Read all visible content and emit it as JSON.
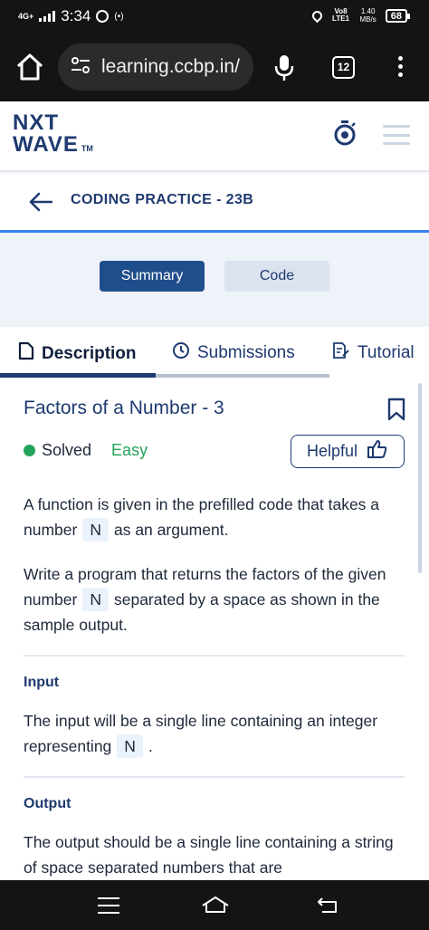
{
  "status_bar": {
    "network": "4G+",
    "time": "3:34",
    "volte": "Vo8 LTE1",
    "speed_value": "1.40",
    "speed_unit": "MB/s",
    "battery": "68"
  },
  "browser": {
    "url": "learning.ccbp.in/",
    "tab_count": "12"
  },
  "app": {
    "logo_line1": "NXT",
    "logo_line2": "WAVE",
    "logo_tm": "TM"
  },
  "page": {
    "back_title": "CODING PRACTICE - 23B"
  },
  "toggle": {
    "summary_label": "Summary",
    "code_label": "Code"
  },
  "tabs": {
    "description": "Description",
    "submissions": "Submissions",
    "tutorial": "Tutorial"
  },
  "problem": {
    "title": "Factors of a Number - 3",
    "status": "Solved",
    "difficulty": "Easy",
    "helpful_label": "Helpful",
    "para1_a": "A function is given in the prefilled code that takes a number",
    "para1_chip": "N",
    "para1_b": "as an argument.",
    "para2_a": "Write a program that returns the factors of the given number",
    "para2_chip": "N",
    "para2_b": "separated by a space as shown in the sample output.",
    "input_heading": "Input",
    "input_a": "The input will be a single line containing an integer representing",
    "input_chip": "N",
    "input_b": ".",
    "output_heading": "Output",
    "output_text": "The output should be a single line containing a string of space separated numbers that are"
  },
  "colors": {
    "brand_navy": "#1e3a6f",
    "accent_blue": "#3b82f6",
    "success_green": "#22a35a"
  }
}
